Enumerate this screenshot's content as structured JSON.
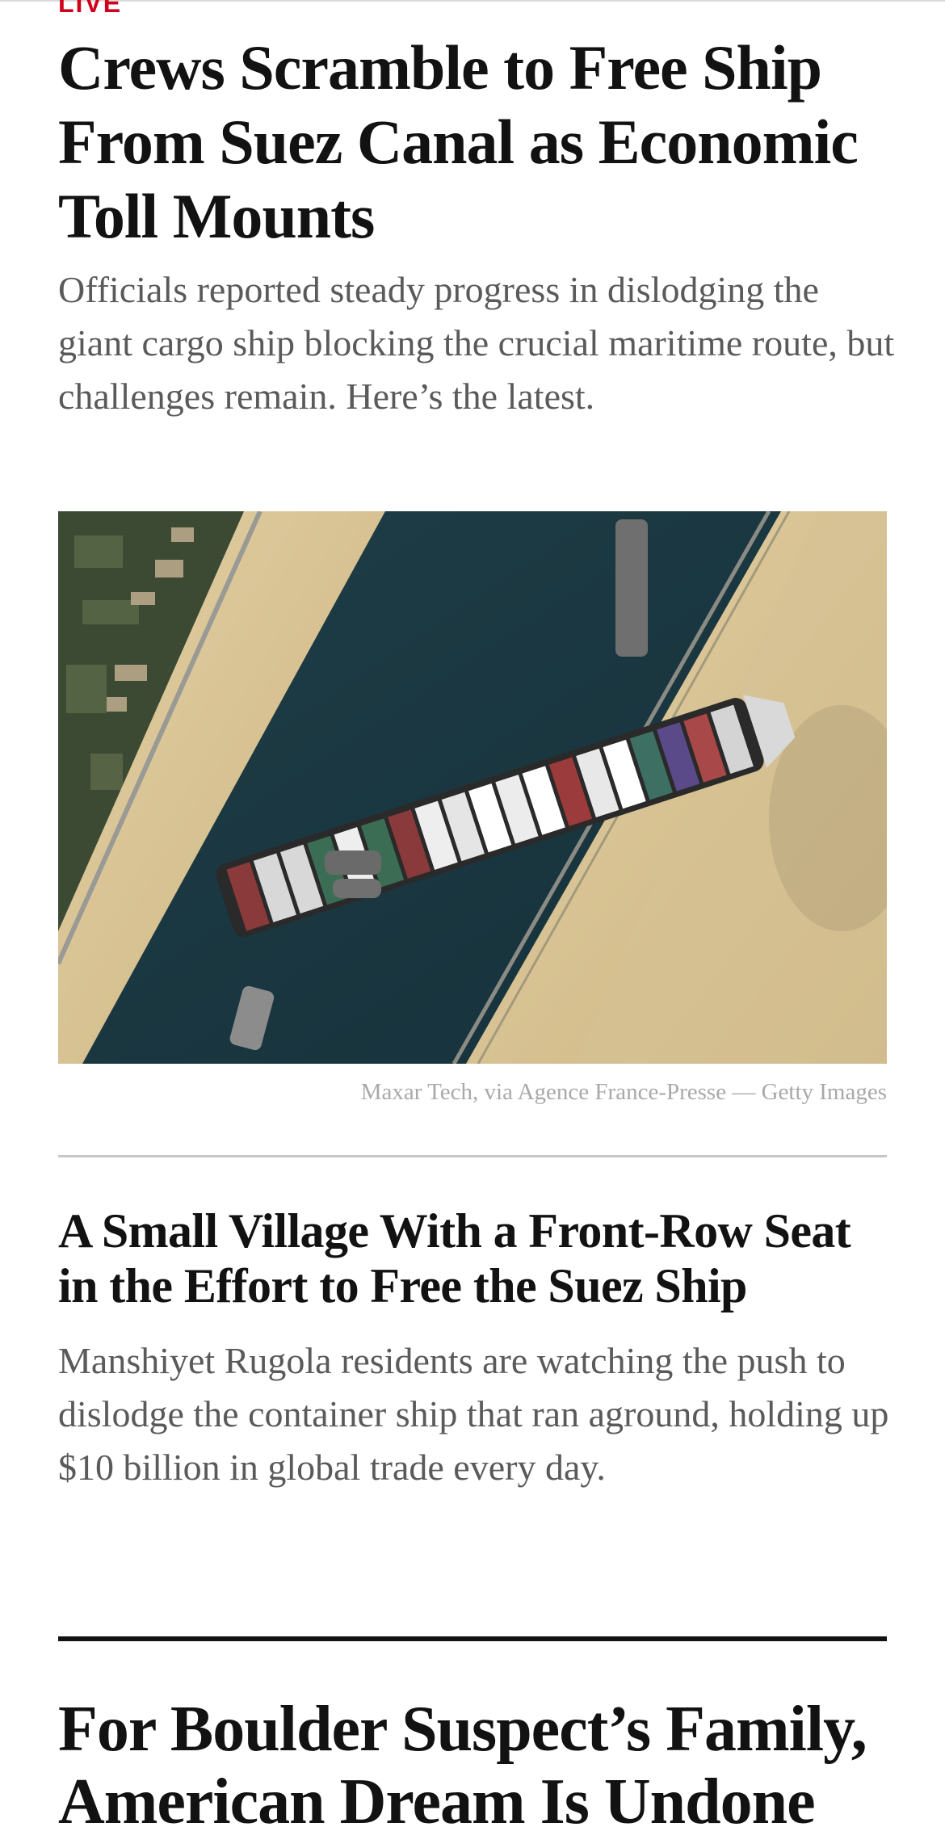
{
  "story1": {
    "live_label": "LIVE",
    "headline": "Crews Scramble to Free Ship From Suez Canal as Economic Toll Mounts",
    "summary": "Officials reported steady progress in dislodging the giant cargo ship blocking the crucial maritime route, but challenges remain. Here’s the latest.",
    "image_credit": "Maxar Tech, via Agence France-Presse — Getty Images"
  },
  "story2": {
    "headline": "A Small Village With a Front-Row Seat in the Effort to Free the Suez Ship",
    "summary": "Manshiyet Rugola residents are watching the push to dislodge the container ship that ran aground, holding up $10 billion in global trade every day."
  },
  "story3": {
    "headline": "For Boulder Suspect’s Family, American Dream Is Undone"
  },
  "colors": {
    "live_red": "#d0021b",
    "headline": "#121212",
    "summary": "#5a5a5a",
    "credit": "#a9a9a9"
  }
}
